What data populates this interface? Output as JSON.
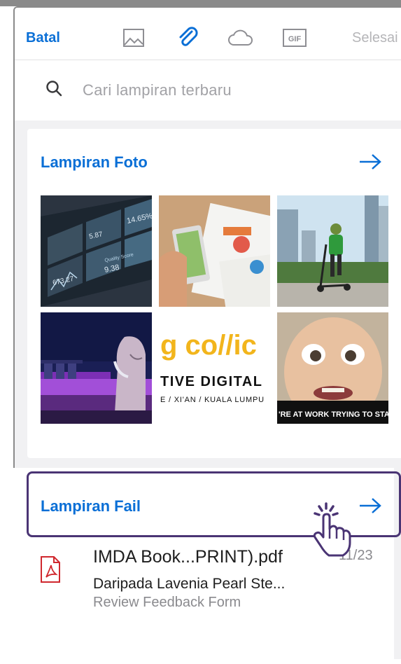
{
  "toolbar": {
    "cancel_label": "Batal",
    "done_label": "Selesai",
    "icons": [
      "image-icon",
      "paperclip-icon",
      "cloud-icon",
      "gif-icon"
    ],
    "gif_label": "GIF"
  },
  "search": {
    "placeholder": "Cari lampiran terbaru"
  },
  "photos": {
    "title": "Lampiran Foto",
    "thumbs": [
      {
        "name": "dashboard-monitor-photo",
        "text_a": "14.65%",
        "text_b": "5.87",
        "text_c": "673.27",
        "text_d": "9.38",
        "text_e": "Quality Score"
      },
      {
        "name": "tablet-charts-photo"
      },
      {
        "name": "scooter-rider-photo"
      },
      {
        "name": "merlion-night-photo"
      },
      {
        "name": "creative-digital-logo",
        "text_a": "g co//ic",
        "text_b": "TIVE DIGITAL",
        "text_c": "E / XI'AN / KUALA LUMPU"
      },
      {
        "name": "baby-meme-photo",
        "text_a": "'RE AT WORK TRYING TO STAY"
      }
    ]
  },
  "files": {
    "title": "Lampiran Fail",
    "items": [
      {
        "filename": "IMDA Book...PRINT).pdf",
        "date": "11/23",
        "sender": "Daripada Lavenia Pearl Ste...",
        "subject": "Review Feedback Form"
      }
    ]
  },
  "colors": {
    "accent": "#0a6fd6",
    "highlight": "#4a3474",
    "pdf_red": "#d0282e"
  }
}
